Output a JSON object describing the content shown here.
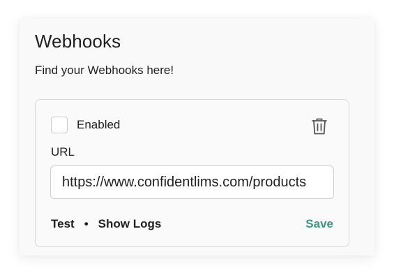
{
  "header": {
    "title": "Webhooks",
    "subtitle": "Find your Webhooks here!"
  },
  "webhook": {
    "enabled_label": "Enabled",
    "enabled": false,
    "url_label": "URL",
    "url_value": "https://www.confidentlims.com/products",
    "test_label": "Test",
    "separator": "•",
    "show_logs_label": "Show Logs",
    "save_label": "Save",
    "delete_icon": "trash-icon"
  },
  "colors": {
    "accent": "#3a9a7f",
    "text": "#222222",
    "border": "#d6d6d6"
  }
}
